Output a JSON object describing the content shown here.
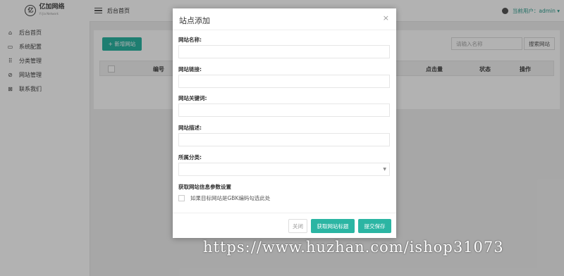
{
  "brand": {
    "name": "亿加网络",
    "sub": "Yi Jia Network"
  },
  "sidebar": {
    "items": [
      {
        "label": "后台首页",
        "icon": "home-icon"
      },
      {
        "label": "系统配置",
        "icon": "monitor-icon"
      },
      {
        "label": "分类管理",
        "icon": "grid-icon"
      },
      {
        "label": "网站管理",
        "icon": "compass-icon"
      },
      {
        "label": "联系我们",
        "icon": "close-box-icon"
      }
    ]
  },
  "topbar": {
    "breadcrumb": "后台首页",
    "current_user": "当前用户：admin ▾"
  },
  "content": {
    "add_button": "+ 新增网站",
    "search_placeholder": "请输入名称",
    "search_button": "搜索网站",
    "columns": [
      "编号",
      "点击量",
      "状态",
      "操作"
    ]
  },
  "modal": {
    "title": "站点添加",
    "close_symbol": "×",
    "fields": [
      {
        "label": "网站名称:",
        "value": ""
      },
      {
        "label": "网站链接:",
        "value": ""
      },
      {
        "label": "网站关键词:",
        "value": ""
      },
      {
        "label": "网站描述:",
        "value": ""
      },
      {
        "label": "所属分类:",
        "value": ""
      }
    ],
    "section_title": "获取网站信息参数设置",
    "gbk_checkbox_label": "如果目标网站是GBK编码勾选此处",
    "gbk_checked": false,
    "buttons": {
      "close": "关闭",
      "fetch": "获取网站标题",
      "submit": "提交保存"
    }
  },
  "watermark": "https://www.huzhan.com/ishop31073",
  "colors": {
    "accent": "#2bb5a3",
    "user_text": "#2f9e8f"
  }
}
